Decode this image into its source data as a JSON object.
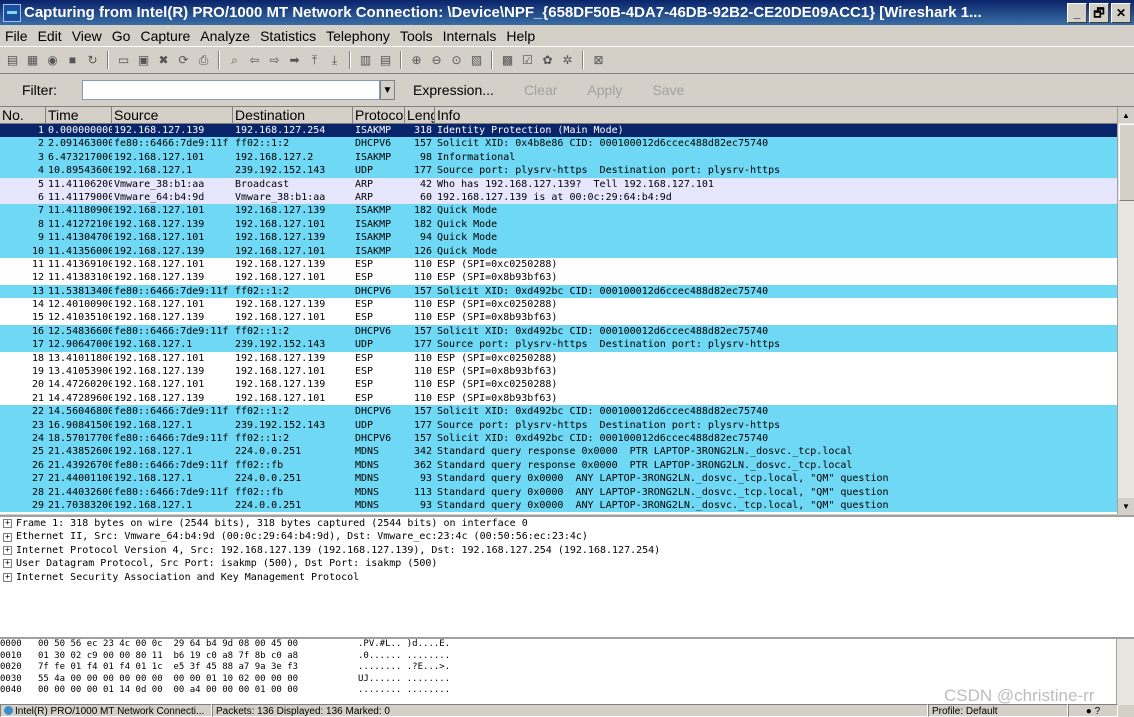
{
  "window": {
    "title": "Capturing from Intel(R) PRO/1000 MT Network Connection: \\Device\\NPF_{658DF50B-4DA7-46DB-92B2-CE20DE09ACC1}   [Wireshark 1...",
    "min": "_",
    "restore": "🗗",
    "close": "✕"
  },
  "menu": [
    "File",
    "Edit",
    "View",
    "Go",
    "Capture",
    "Analyze",
    "Statistics",
    "Telephony",
    "Tools",
    "Internals",
    "Help"
  ],
  "filter": {
    "label": "Filter:",
    "value": "",
    "expression": "Expression...",
    "clear": "Clear",
    "apply": "Apply",
    "save": "Save"
  },
  "columns": [
    "No.",
    "Time",
    "Source",
    "Destination",
    "Protocol",
    "Length",
    "Info"
  ],
  "colors": {
    "selected": "#0a246a",
    "cyan": "#6fd8f5",
    "light": "#e7e6ff",
    "white": "#ffffff"
  },
  "packets": [
    {
      "no": "1",
      "time": "0.000000000",
      "src": "192.168.127.139",
      "dst": "192.168.127.254",
      "proto": "ISAKMP",
      "len": "318",
      "info": "Identity Protection (Main Mode)",
      "color": "selected"
    },
    {
      "no": "2",
      "time": "2.091463000",
      "src": "fe80::6466:7de9:11f",
      "dst": "ff02::1:2",
      "proto": "DHCPV6",
      "len": "157",
      "info": "Solicit XID: 0x4b8e86 CID: 000100012d6ccec488d82ec75740",
      "color": "cyan"
    },
    {
      "no": "3",
      "time": "6.473217000",
      "src": "192.168.127.101",
      "dst": "192.168.127.2",
      "proto": "ISAKMP",
      "len": "98",
      "info": "Informational",
      "color": "cyan"
    },
    {
      "no": "4",
      "time": "10.89543600",
      "src": "192.168.127.1",
      "dst": "239.192.152.143",
      "proto": "UDP",
      "len": "177",
      "info": "Source port: plysrv-https  Destination port: plysrv-https",
      "color": "cyan"
    },
    {
      "no": "5",
      "time": "11.41106200",
      "src": "Vmware_38:b1:aa",
      "dst": "Broadcast",
      "proto": "ARP",
      "len": "42",
      "info": "Who has 192.168.127.139?  Tell 192.168.127.101",
      "color": "light"
    },
    {
      "no": "6",
      "time": "11.41179000",
      "src": "Vmware_64:b4:9d",
      "dst": "Vmware_38:b1:aa",
      "proto": "ARP",
      "len": "60",
      "info": "192.168.127.139 is at 00:0c:29:64:b4:9d",
      "color": "light"
    },
    {
      "no": "7",
      "time": "11.41180900",
      "src": "192.168.127.101",
      "dst": "192.168.127.139",
      "proto": "ISAKMP",
      "len": "182",
      "info": "Quick Mode",
      "color": "cyan"
    },
    {
      "no": "8",
      "time": "11.41272100",
      "src": "192.168.127.139",
      "dst": "192.168.127.101",
      "proto": "ISAKMP",
      "len": "182",
      "info": "Quick Mode",
      "color": "cyan"
    },
    {
      "no": "9",
      "time": "11.41304700",
      "src": "192.168.127.101",
      "dst": "192.168.127.139",
      "proto": "ISAKMP",
      "len": "94",
      "info": "Quick Mode",
      "color": "cyan"
    },
    {
      "no": "10",
      "time": "11.41356000",
      "src": "192.168.127.139",
      "dst": "192.168.127.101",
      "proto": "ISAKMP",
      "len": "126",
      "info": "Quick Mode",
      "color": "cyan"
    },
    {
      "no": "11",
      "time": "11.41369100",
      "src": "192.168.127.101",
      "dst": "192.168.127.139",
      "proto": "ESP",
      "len": "110",
      "info": "ESP (SPI=0xc0250288)",
      "color": "white"
    },
    {
      "no": "12",
      "time": "11.41383100",
      "src": "192.168.127.139",
      "dst": "192.168.127.101",
      "proto": "ESP",
      "len": "110",
      "info": "ESP (SPI=0x8b93bf63)",
      "color": "white"
    },
    {
      "no": "13",
      "time": "11.53813400",
      "src": "fe80::6466:7de9:11f",
      "dst": "ff02::1:2",
      "proto": "DHCPV6",
      "len": "157",
      "info": "Solicit XID: 0xd492bc CID: 000100012d6ccec488d82ec75740",
      "color": "cyan"
    },
    {
      "no": "14",
      "time": "12.40100900",
      "src": "192.168.127.101",
      "dst": "192.168.127.139",
      "proto": "ESP",
      "len": "110",
      "info": "ESP (SPI=0xc0250288)",
      "color": "white"
    },
    {
      "no": "15",
      "time": "12.41035100",
      "src": "192.168.127.139",
      "dst": "192.168.127.101",
      "proto": "ESP",
      "len": "110",
      "info": "ESP (SPI=0x8b93bf63)",
      "color": "white"
    },
    {
      "no": "16",
      "time": "12.54836600",
      "src": "fe80::6466:7de9:11f",
      "dst": "ff02::1:2",
      "proto": "DHCPV6",
      "len": "157",
      "info": "Solicit XID: 0xd492bc CID: 000100012d6ccec488d82ec75740",
      "color": "cyan"
    },
    {
      "no": "17",
      "time": "12.90647000",
      "src": "192.168.127.1",
      "dst": "239.192.152.143",
      "proto": "UDP",
      "len": "177",
      "info": "Source port: plysrv-https  Destination port: plysrv-https",
      "color": "cyan"
    },
    {
      "no": "18",
      "time": "13.41011800",
      "src": "192.168.127.101",
      "dst": "192.168.127.139",
      "proto": "ESP",
      "len": "110",
      "info": "ESP (SPI=0xc0250288)",
      "color": "white"
    },
    {
      "no": "19",
      "time": "13.41053900",
      "src": "192.168.127.139",
      "dst": "192.168.127.101",
      "proto": "ESP",
      "len": "110",
      "info": "ESP (SPI=0x8b93bf63)",
      "color": "white"
    },
    {
      "no": "20",
      "time": "14.47260200",
      "src": "192.168.127.101",
      "dst": "192.168.127.139",
      "proto": "ESP",
      "len": "110",
      "info": "ESP (SPI=0xc0250288)",
      "color": "white"
    },
    {
      "no": "21",
      "time": "14.47289600",
      "src": "192.168.127.139",
      "dst": "192.168.127.101",
      "proto": "ESP",
      "len": "110",
      "info": "ESP (SPI=0x8b93bf63)",
      "color": "white"
    },
    {
      "no": "22",
      "time": "14.56046800",
      "src": "fe80::6466:7de9:11f",
      "dst": "ff02::1:2",
      "proto": "DHCPV6",
      "len": "157",
      "info": "Solicit XID: 0xd492bc CID: 000100012d6ccec488d82ec75740",
      "color": "cyan"
    },
    {
      "no": "23",
      "time": "16.90841500",
      "src": "192.168.127.1",
      "dst": "239.192.152.143",
      "proto": "UDP",
      "len": "177",
      "info": "Source port: plysrv-https  Destination port: plysrv-https",
      "color": "cyan"
    },
    {
      "no": "24",
      "time": "18.57017700",
      "src": "fe80::6466:7de9:11f",
      "dst": "ff02::1:2",
      "proto": "DHCPV6",
      "len": "157",
      "info": "Solicit XID: 0xd492bc CID: 000100012d6ccec488d82ec75740",
      "color": "cyan"
    },
    {
      "no": "25",
      "time": "21.43852600",
      "src": "192.168.127.1",
      "dst": "224.0.0.251",
      "proto": "MDNS",
      "len": "342",
      "info": "Standard query response 0x0000  PTR LAPTOP-3RONG2LN._dosvc._tcp.local",
      "color": "cyan"
    },
    {
      "no": "26",
      "time": "21.43926700",
      "src": "fe80::6466:7de9:11f",
      "dst": "ff02::fb",
      "proto": "MDNS",
      "len": "362",
      "info": "Standard query response 0x0000  PTR LAPTOP-3RONG2LN._dosvc._tcp.local",
      "color": "cyan"
    },
    {
      "no": "27",
      "time": "21.44001100",
      "src": "192.168.127.1",
      "dst": "224.0.0.251",
      "proto": "MDNS",
      "len": "93",
      "info": "Standard query 0x0000  ANY LAPTOP-3RONG2LN._dosvc._tcp.local, \"QM\" question",
      "color": "cyan"
    },
    {
      "no": "28",
      "time": "21.44032600",
      "src": "fe80::6466:7de9:11f",
      "dst": "ff02::fb",
      "proto": "MDNS",
      "len": "113",
      "info": "Standard query 0x0000  ANY LAPTOP-3RONG2LN._dosvc._tcp.local, \"QM\" question",
      "color": "cyan"
    },
    {
      "no": "29",
      "time": "21.70383200",
      "src": "192.168.127.1",
      "dst": "224.0.0.251",
      "proto": "MDNS",
      "len": "93",
      "info": "Standard query 0x0000  ANY LAPTOP-3RONG2LN._dosvc._tcp.local, \"QM\" question",
      "color": "cyan"
    }
  ],
  "details": [
    "Frame 1: 318 bytes on wire (2544 bits), 318 bytes captured (2544 bits) on interface 0",
    "Ethernet II, Src: Vmware_64:b4:9d (00:0c:29:64:b4:9d), Dst: Vmware_ec:23:4c (00:50:56:ec:23:4c)",
    "Internet Protocol Version 4, Src: 192.168.127.139 (192.168.127.139), Dst: 192.168.127.254 (192.168.127.254)",
    "User Datagram Protocol, Src Port: isakmp (500), Dst Port: isakmp (500)",
    "Internet Security Association and Key Management Protocol"
  ],
  "hex": [
    {
      "off": "0000",
      "bytes": "00 50 56 ec 23 4c 00 0c  29 64 b4 9d 08 00 45 00",
      "ascii": ".PV.#L.. )d....E."
    },
    {
      "off": "0010",
      "bytes": "01 30 02 c9 00 00 80 11  b6 19 c0 a8 7f 8b c0 a8",
      "ascii": ".0...... ........"
    },
    {
      "off": "0020",
      "bytes": "7f fe 01 f4 01 f4 01 1c  e5 3f 45 88 a7 9a 3e f3",
      "ascii": "........ .?E...>."
    },
    {
      "off": "0030",
      "bytes": "55 4a 00 00 00 00 00 00  00 00 01 10 02 00 00 00",
      "ascii": "UJ...... ........"
    },
    {
      "off": "0040",
      "bytes": "00 00 00 00 01 14 0d 00  00 a4 00 00 00 01 00 00",
      "ascii": "........ ........"
    }
  ],
  "status": {
    "iface": "Intel(R) PRO/1000 MT Network Connecti...",
    "packets": "Packets: 136 Displayed: 136 Marked: 0",
    "profile": "Profile: Default"
  },
  "watermark": "CSDN @christine-rr"
}
